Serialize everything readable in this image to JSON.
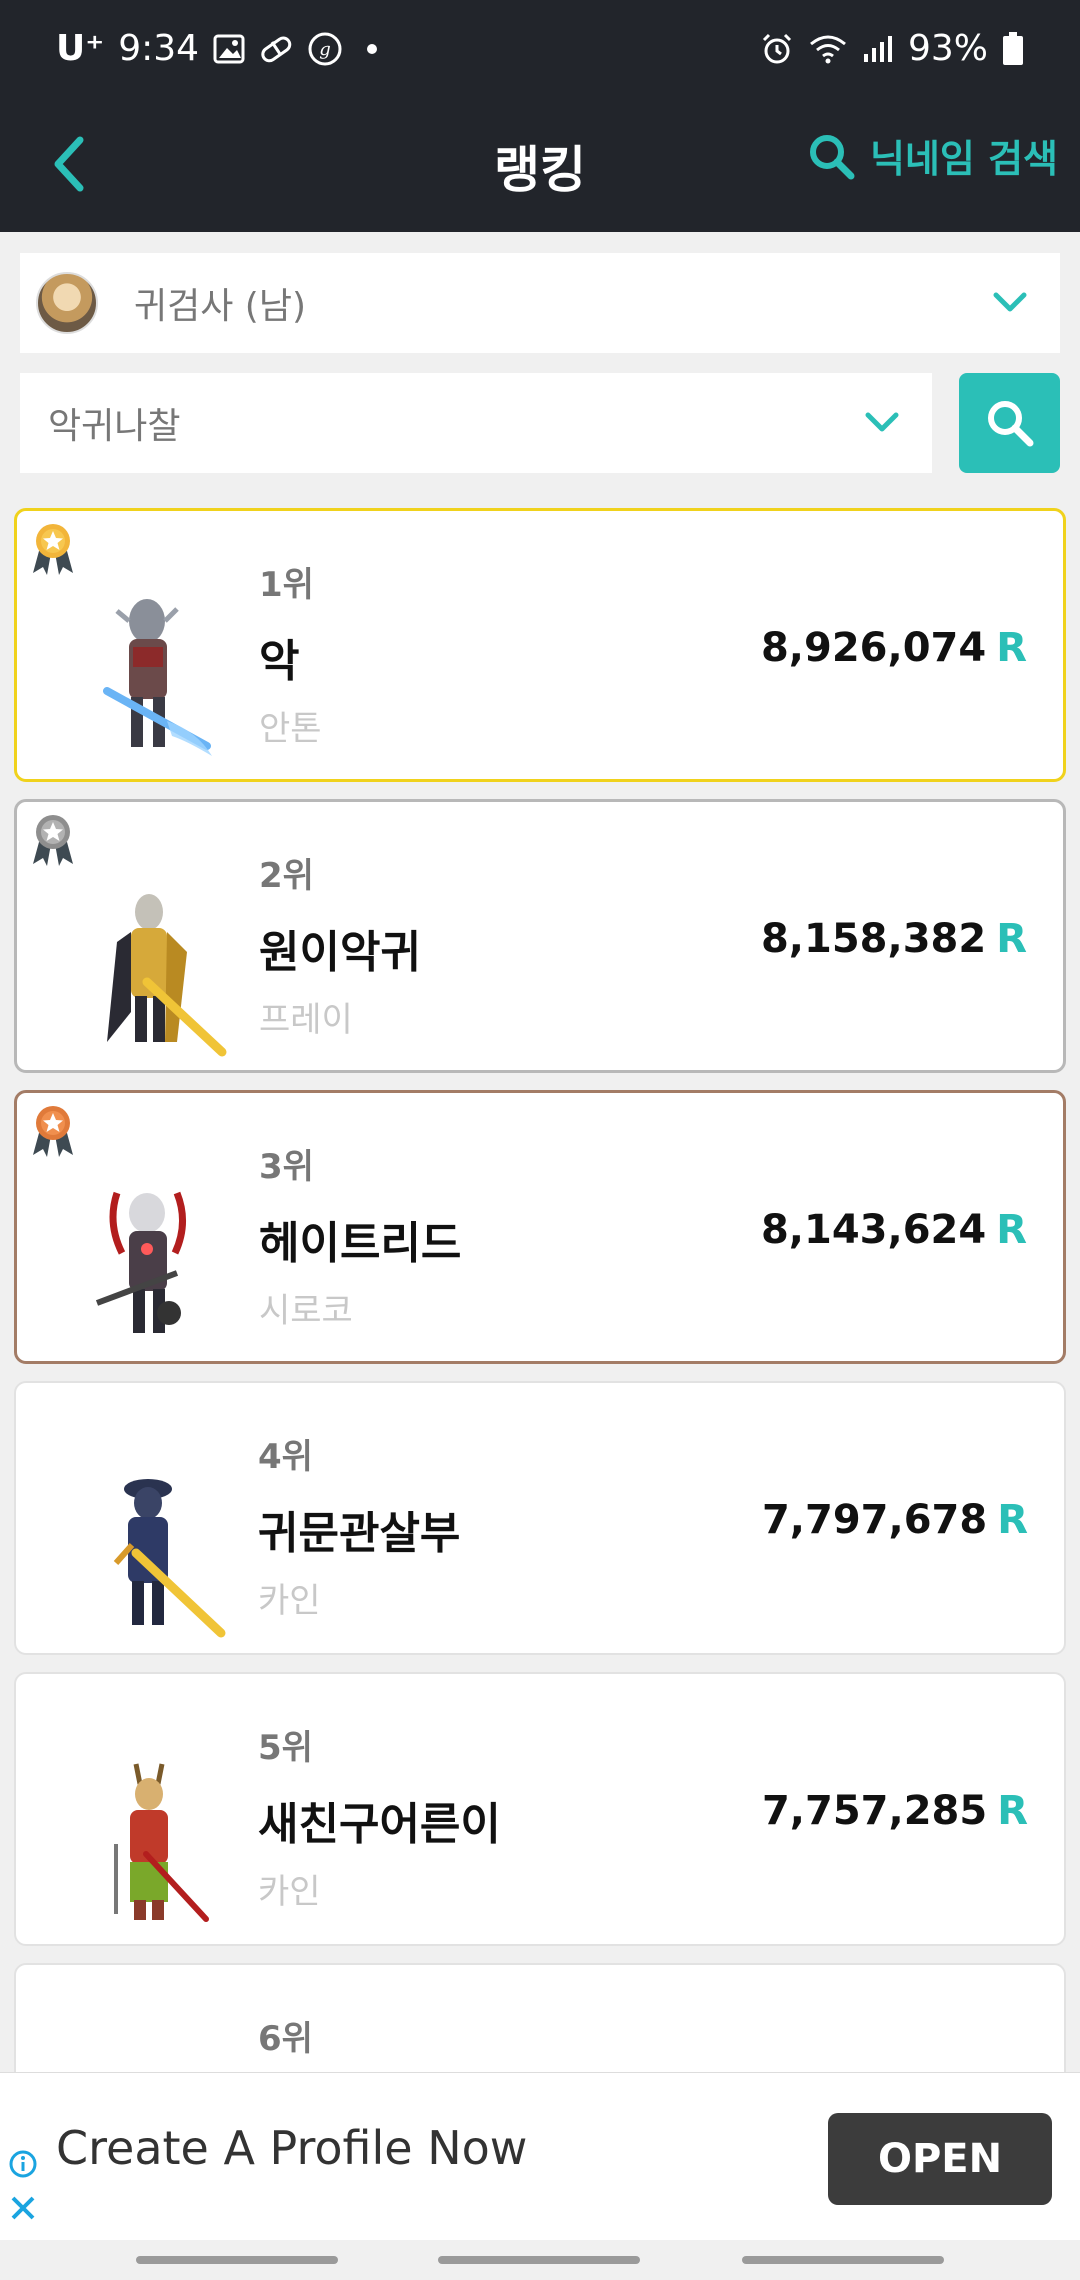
{
  "status_bar": {
    "carrier": "U⁺",
    "time": "9:34",
    "battery": "93%",
    "icons": [
      "image-icon",
      "pill-icon",
      "g-circle-icon",
      "dot-icon",
      "alarm-icon",
      "wifi-icon",
      "signal-icon",
      "battery-icon"
    ]
  },
  "header": {
    "title": "랭킹",
    "search_label": "닉네임 검색",
    "accent_color": "#2bbfb7",
    "background_color": "#22252b"
  },
  "filters": {
    "class_select": "귀검사 (남)",
    "title_select": "악귀나찰"
  },
  "rankings": [
    {
      "rank": "1위",
      "name": "악",
      "server": "안톤",
      "score": "8,926,074",
      "unit": "R",
      "medal": "gold"
    },
    {
      "rank": "2위",
      "name": "원이악귀",
      "server": "프레이",
      "score": "8,158,382",
      "unit": "R",
      "medal": "silver"
    },
    {
      "rank": "3위",
      "name": "헤이트리드",
      "server": "시로코",
      "score": "8,143,624",
      "unit": "R",
      "medal": "bronze"
    },
    {
      "rank": "4위",
      "name": "귀문관살부",
      "server": "카인",
      "score": "7,797,678",
      "unit": "R",
      "medal": "none"
    },
    {
      "rank": "5위",
      "name": "새친구어른이",
      "server": "카인",
      "score": "7,757,285",
      "unit": "R",
      "medal": "none"
    },
    {
      "rank": "6위",
      "name": "",
      "server": "",
      "score": "",
      "unit": "",
      "medal": "none"
    }
  ],
  "ad": {
    "text": "Create A Profile Now",
    "button": "OPEN"
  }
}
